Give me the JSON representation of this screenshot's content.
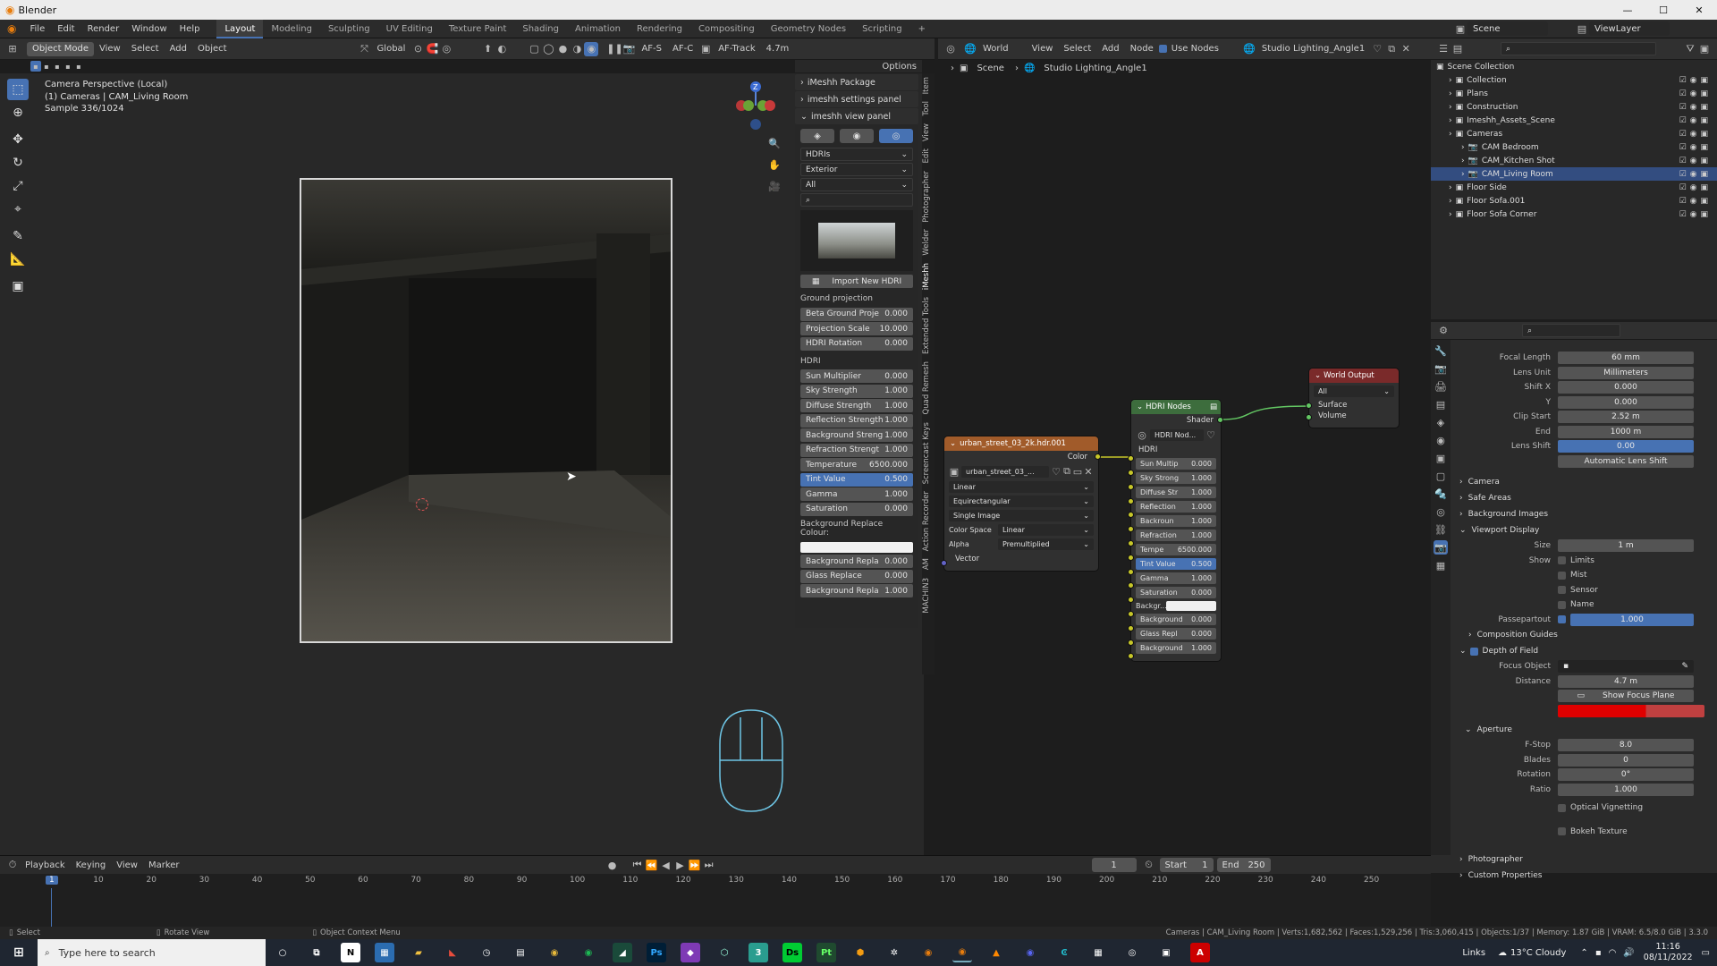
{
  "titlebar": {
    "app_title": "Blender"
  },
  "menubar": {
    "menus": [
      "File",
      "Edit",
      "Render",
      "Window",
      "Help"
    ],
    "workspaces": [
      "Layout",
      "Modeling",
      "Sculpting",
      "UV Editing",
      "Texture Paint",
      "Shading",
      "Animation",
      "Rendering",
      "Compositing",
      "Geometry Nodes",
      "Scripting"
    ],
    "active_workspace": "Layout",
    "add_tab": "+",
    "scene": "Scene",
    "view_layer": "ViewLayer"
  },
  "viewport_header": {
    "mode": "Object Mode",
    "menus": [
      "View",
      "Select",
      "Add",
      "Object"
    ],
    "transform": "Global",
    "af_s": "AF-S",
    "af_c": "AF-C",
    "af_track": "AF-Track",
    "distance": "4.7m",
    "options": "Options"
  },
  "viewport": {
    "overlay_line1": "Camera Perspective (Local)",
    "overlay_line2": "(1) Cameras | CAM_Living Room",
    "overlay_line3": "Sample 336/1024",
    "gizmo_z": "Z"
  },
  "npanel": {
    "packages": [
      "iMeshh Package",
      "imeshh settings panel",
      "imeshh view panel"
    ],
    "dropdowns": [
      "HDRIs",
      "Exterior",
      "All"
    ],
    "import_button": "Import New HDRI",
    "ground_label": "Ground projection",
    "ground_fields": [
      {
        "label": "Beta Ground Proje",
        "value": "0.000"
      },
      {
        "label": "Projection Scale",
        "value": "10.000"
      },
      {
        "label": "HDRI Rotation",
        "value": "0.000"
      }
    ],
    "hdri_label": "HDRI",
    "hdri_fields": [
      {
        "label": "Sun Multiplier",
        "value": "0.000"
      },
      {
        "label": "Sky Strength",
        "value": "1.000"
      },
      {
        "label": "Diffuse Strength",
        "value": "1.000"
      },
      {
        "label": "Reflection Strength",
        "value": "1.000"
      },
      {
        "label": "Background Streng",
        "value": "1.000"
      },
      {
        "label": "Refraction Strengt",
        "value": "1.000"
      },
      {
        "label": "Temperature",
        "value": "6500.000"
      },
      {
        "label": "Tint Value",
        "value": "0.500"
      },
      {
        "label": "Gamma",
        "value": "1.000"
      },
      {
        "label": "Saturation",
        "value": "0.000"
      }
    ],
    "bg_replace_label": "Background Replace Colour:",
    "bg_fields": [
      {
        "label": "Background Repla",
        "value": "0.000"
      },
      {
        "label": "Glass Replace",
        "value": "0.000"
      },
      {
        "label": "Background Repla",
        "value": "1.000"
      }
    ]
  },
  "vtabs": [
    "Item",
    "Tool",
    "View",
    "Edit",
    "Photographer",
    "Welder",
    "iMeshh",
    "Extended Tools",
    "Quad Remesh",
    "Screencast Keys",
    "Action Recorder",
    "AM",
    "MACHIN3"
  ],
  "node_header": {
    "world_label": "World",
    "menus": [
      "View",
      "Select",
      "Add",
      "Node"
    ],
    "use_nodes": "Use Nodes",
    "world_name": "Studio Lighting_Angle1",
    "breadcrumb_scene": "Scene",
    "breadcrumb_world": "Studio Lighting_Angle1"
  },
  "nodes": {
    "env_title": "urban_street_03_2k.hdr.001",
    "env_color": "Color",
    "env_image": "urban_street_03_...",
    "env_interp": "Linear",
    "env_proj": "Equirectangular",
    "env_source": "Single Image",
    "env_colorspace_label": "Color Space",
    "env_colorspace": "Linear",
    "env_alpha_label": "Alpha",
    "env_alpha": "Premultiplied",
    "env_vector": "Vector",
    "group_title": "HDRI Nodes",
    "group_shader": "Shader",
    "group_nodetree": "HDRI Nod...",
    "group_hdri": "HDRI",
    "group_fields": [
      {
        "label": "Sun Multip",
        "value": "0.000"
      },
      {
        "label": "Sky Strong",
        "value": "1.000"
      },
      {
        "label": "Diffuse Str",
        "value": "1.000"
      },
      {
        "label": "Reflection",
        "value": "1.000"
      },
      {
        "label": "Backroun",
        "value": "1.000"
      },
      {
        "label": "Refraction",
        "value": "1.000"
      },
      {
        "label": "Tempe",
        "value": "6500.000"
      },
      {
        "label": "Tint Value",
        "value": "0.500"
      },
      {
        "label": "Gamma",
        "value": "1.000"
      },
      {
        "label": "Saturation",
        "value": "0.000"
      }
    ],
    "group_backgr": "Backgr...",
    "group_fields2": [
      {
        "label": "Background",
        "value": "0.000"
      },
      {
        "label": "Glass Repl",
        "value": "0.000"
      },
      {
        "label": "Background",
        "value": "1.000"
      }
    ],
    "output_title": "World Output",
    "output_target": "All",
    "output_surface": "Surface",
    "output_volume": "Volume"
  },
  "outliner": {
    "root": "Scene Collection",
    "items": [
      {
        "name": "Collection",
        "indent": 1
      },
      {
        "name": "Plans",
        "indent": 1
      },
      {
        "name": "Construction",
        "indent": 1
      },
      {
        "name": "Imeshh_Assets_Scene",
        "indent": 1
      },
      {
        "name": "Cameras",
        "indent": 1
      },
      {
        "name": "CAM Bedroom",
        "indent": 2
      },
      {
        "name": "CAM_Kitchen Shot",
        "indent": 2
      },
      {
        "name": "CAM_Living Room",
        "indent": 2,
        "selected": true
      },
      {
        "name": "Floor Side",
        "indent": 1
      },
      {
        "name": "Floor Sofa.001",
        "indent": 1
      },
      {
        "name": "Floor Sofa Corner",
        "indent": 1
      }
    ]
  },
  "properties": {
    "rows": [
      {
        "label": "Focal Length",
        "value": "60 mm"
      },
      {
        "label": "Lens Unit",
        "value": "Millimeters"
      },
      {
        "label": "Shift X",
        "value": "0.000"
      },
      {
        "label": "Y",
        "value": "0.000"
      },
      {
        "label": "Clip Start",
        "value": "2.52 m"
      },
      {
        "label": "End",
        "value": "1000 m"
      },
      {
        "label": "Lens Shift",
        "value": "0.00"
      }
    ],
    "auto_lens_shift": "Automatic Lens Shift",
    "sections": [
      "Camera",
      "Safe Areas",
      "Background Images",
      "Viewport Display"
    ],
    "size_label": "Size",
    "size_value": "1 m",
    "show_label": "Show",
    "show_opts": [
      "Limits",
      "Mist",
      "Sensor",
      "Name"
    ],
    "passepartout_label": "Passepartout",
    "passepartout_value": "1.000",
    "composition_guides": "Composition Guides",
    "dof": "Depth of Field",
    "focus_object": "Focus Object",
    "distance_label": "Distance",
    "distance_value": "4.7 m",
    "show_focus_plane": "Show Focus Plane",
    "aperture": "Aperture",
    "aperture_rows": [
      {
        "label": "F-Stop",
        "value": "8.0"
      },
      {
        "label": "Blades",
        "value": "0"
      },
      {
        "label": "Rotation",
        "value": "0°"
      },
      {
        "label": "Ratio",
        "value": "1.000"
      }
    ],
    "optical_vignetting": "Optical Vignetting",
    "bokeh_texture": "Bokeh Texture",
    "photographer": "Photographer",
    "custom_properties": "Custom Properties"
  },
  "timeline": {
    "menus": [
      "Playback",
      "Keying",
      "View",
      "Marker"
    ],
    "current_frame": "1",
    "start_label": "Start",
    "start": "1",
    "end_label": "End",
    "end": "250",
    "ticks": [
      "1",
      "10",
      "20",
      "30",
      "40",
      "50",
      "60",
      "70",
      "80",
      "90",
      "100",
      "110",
      "120",
      "130",
      "140",
      "150",
      "160",
      "170",
      "180",
      "190",
      "200",
      "210",
      "220",
      "230",
      "240",
      "250"
    ]
  },
  "statusbar": {
    "select": "Select",
    "rotate": "Rotate View",
    "context": "Object Context Menu",
    "stats": "Cameras | CAM_Living Room | Verts:1,682,562 | Faces:1,529,256 | Tris:3,060,415 | Objects:1/37 | Memory: 1.87 GiB | VRAM: 6.5/8.0 GiB | 3.3.0"
  },
  "taskbar": {
    "search_placeholder": "Type here to search",
    "links": "Links",
    "weather": "13°C  Cloudy",
    "time": "11:16",
    "date": "08/11/2022",
    "app_labels": [
      "N",
      "Ps",
      "Ds",
      "Pt",
      "3"
    ]
  },
  "colors": {
    "accent": "#4772b3",
    "selected_row": "#334d80",
    "env_node_header": "#a15b2a",
    "group_node_header": "#3d6d3d",
    "output_node_header": "#7a2a2a",
    "focus_plane": "#e00000"
  }
}
